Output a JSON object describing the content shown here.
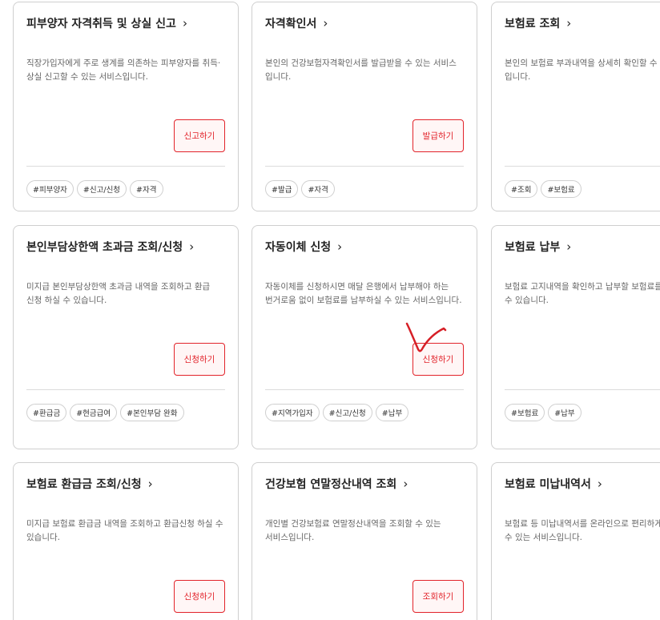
{
  "cards": [
    {
      "title": "피부양자 자격취득 및 상실 신고",
      "description": "직장가입자에게 주로 생계를 의존하는 피부양자를 취득·상실 신고할 수 있는 서비스입니다.",
      "button": "신고하기",
      "tags": [
        "#피부양자",
        "#신고/신청",
        "#자격"
      ]
    },
    {
      "title": "자격확인서",
      "description": "본인의 건강보험자격확인서를 발급받을 수 있는 서비스 입니다.",
      "button": "발급하기",
      "tags": [
        "#발급",
        "#자격"
      ]
    },
    {
      "title": "보험료 조회",
      "description": "본인의 보험료 부과내역을 상세히 확인할 수 있는 서비스 입니다.",
      "button": "",
      "tags": [
        "#조회",
        "#보험료"
      ]
    },
    {
      "title": "본인부담상한액 초과금 조회/신청",
      "description": "미지급 본인부담상한액 초과금 내역을 조회하고 환급 신청 하실 수 있습니다.",
      "button": "신청하기",
      "tags": [
        "#환급금",
        "#현금급여",
        "#본인부담 완화"
      ]
    },
    {
      "title": "자동이체 신청",
      "description": "자동이체를 신청하시면 매달 은행에서 납부해야 하는 번거로움 없이 보험료를 납부하실 수 있는 서비스입니다.",
      "button": "신청하기",
      "tags": [
        "#지역가입자",
        "#신고/신청",
        "#납부"
      ]
    },
    {
      "title": "보험료 납부",
      "description": "보험료 고지내역을 확인하고 납부할 보험료를 납부하실 수 있습니다.",
      "button": "",
      "tags": [
        "#보험료",
        "#납부"
      ]
    },
    {
      "title": "보험료 환급금 조회/신청",
      "description": "미지급 보험료 환급금 내역을 조회하고 환급신청 하실 수 있습니다.",
      "button": "신청하기",
      "tags": []
    },
    {
      "title": "건강보험 연말정산내역 조회",
      "description": "개인별 건강보험료 연말정산내역을 조회할 수 있는 서비스입니다.",
      "button": "조회하기",
      "tags": []
    },
    {
      "title": "보험료 미납내역서",
      "description": "보험료 등 미납내역서를 온라인으로 편리하게 발급받을 수 있는 서비스입니다.",
      "button": "",
      "tags": []
    }
  ],
  "colors": {
    "accent": "#e2232a",
    "annotation": "#d61f26"
  }
}
